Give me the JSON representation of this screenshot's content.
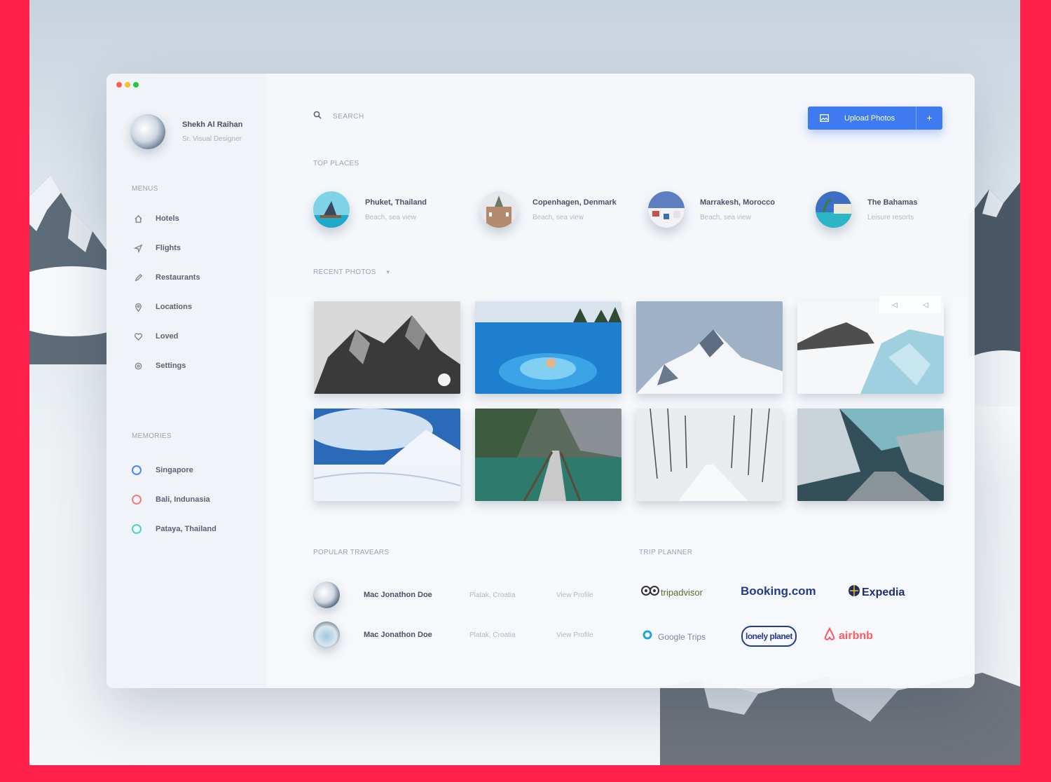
{
  "window": {
    "traffic_colors": [
      "#ff5f57",
      "#febc2e",
      "#28c840"
    ]
  },
  "profile": {
    "name": "Shekh Al Raihan",
    "role": "Sr. Visual Designer"
  },
  "sidebar": {
    "menus_label": "MENUS",
    "items": [
      {
        "label": "Hotels",
        "icon": "home-icon"
      },
      {
        "label": "Flights",
        "icon": "paper-plane-icon"
      },
      {
        "label": "Restaurants",
        "icon": "pencil-icon"
      },
      {
        "label": "Locations",
        "icon": "map-pin-icon"
      },
      {
        "label": "Loved",
        "icon": "heart-icon"
      },
      {
        "label": "Settings",
        "icon": "gear-icon"
      }
    ],
    "memories_label": "MEMORIES",
    "memories": [
      {
        "label": "Singapore",
        "color": "#4d86f5"
      },
      {
        "label": "Bali, Indunasia",
        "color": "#f57a7a"
      },
      {
        "label": "Pataya, Thailand",
        "color": "#49d3c7"
      }
    ]
  },
  "search": {
    "placeholder": "SEARCH"
  },
  "upload": {
    "label": "Upload Photos",
    "plus": "+",
    "color": "#3f7bf0"
  },
  "top_places": {
    "title": "TOP PLACES",
    "items": [
      {
        "name": "Phuket, Thailand",
        "sub": "Beach, sea view"
      },
      {
        "name": "Copenhagen, Denmark",
        "sub": "Beach, sea view"
      },
      {
        "name": "Marrakesh, Morocco",
        "sub": "Beach, sea view"
      },
      {
        "name": "The Bahamas",
        "sub": "Leisure resorts"
      }
    ]
  },
  "recent_photos": {
    "title": "RECENT PHOTOS",
    "photos": [
      "bw-mountain-photo",
      "infinity-pool-photo",
      "snow-peak-photo",
      "glacier-photo",
      "snowfield-photo",
      "fjord-bridge-photo",
      "snowy-road-photo",
      "frozen-forest-photo"
    ]
  },
  "popular_travelers": {
    "title": "POPULAR TRAVEARS",
    "items": [
      {
        "name": "Mac Jonathon Doe",
        "location": "Platak, Croatia",
        "action": "View Profile"
      },
      {
        "name": "Mac Jonathon Doe",
        "location": "Platak, Croatia",
        "action": "View Profile"
      }
    ]
  },
  "trip_planner": {
    "title": "TRIP PLANNER",
    "brands": [
      {
        "name": "tripadvisor",
        "color": "#5a6b2e"
      },
      {
        "name": "Booking.com",
        "color": "#213d8a"
      },
      {
        "name": "Expedia",
        "color": "#1e2c6a"
      },
      {
        "name": "Google Trips",
        "color": "#7e8799"
      },
      {
        "name": "lonely planet",
        "color": "#253a8c"
      },
      {
        "name": "airbnb",
        "color": "#ff5a5f"
      }
    ]
  }
}
